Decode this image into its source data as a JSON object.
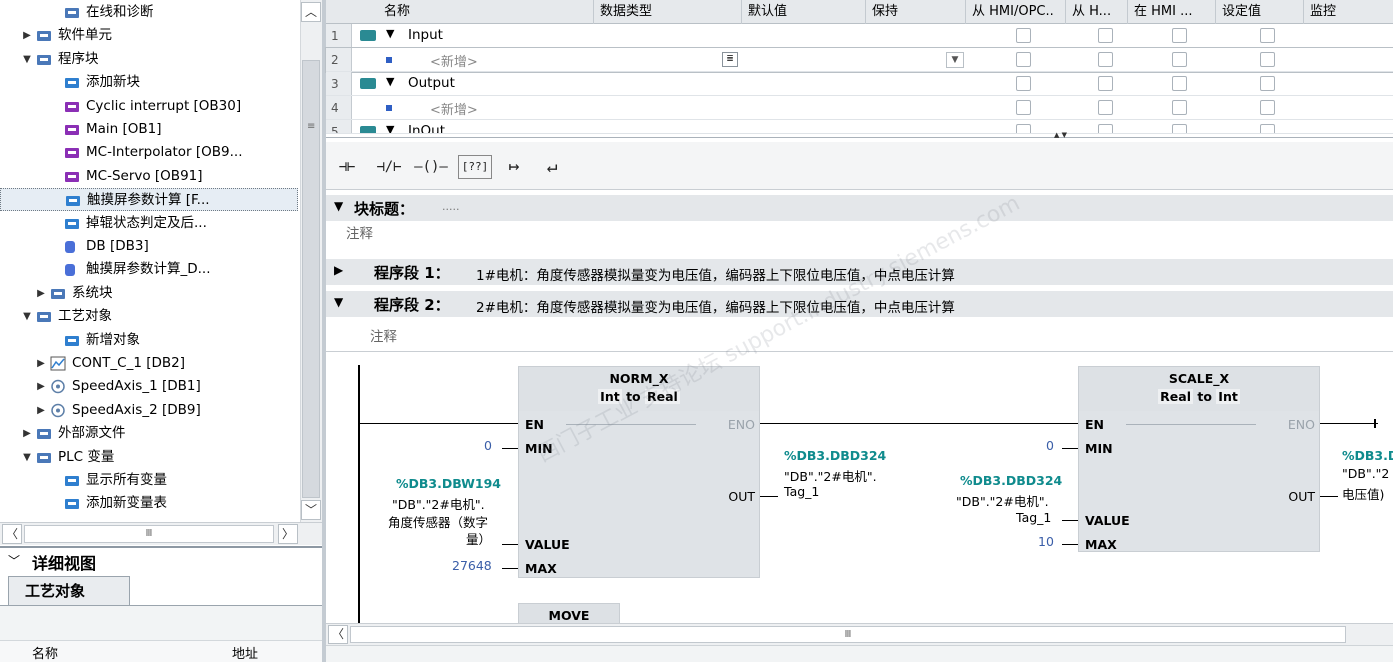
{
  "tree": {
    "items": [
      {
        "label": "在线和诊断",
        "icon": "online-diagnostics-icon",
        "arrow": ""
      },
      {
        "label": "软件单元",
        "icon": "software-unit-icon",
        "arrow": "▶"
      },
      {
        "label": "程序块",
        "icon": "program-blocks-icon",
        "arrow": "▼"
      },
      {
        "label": "添加新块",
        "icon": "add-block-icon",
        "arrow": ""
      },
      {
        "label": "Cyclic interrupt [OB30]",
        "icon": "ob-icon",
        "arrow": ""
      },
      {
        "label": "Main [OB1]",
        "icon": "ob-icon",
        "arrow": ""
      },
      {
        "label": "MC-Interpolator [OB9...",
        "icon": "ob-mc-icon",
        "arrow": ""
      },
      {
        "label": "MC-Servo [OB91]",
        "icon": "ob-mc-icon",
        "arrow": ""
      },
      {
        "label": "触摸屏参数计算 [F...",
        "icon": "fc-icon",
        "arrow": ""
      },
      {
        "label": "掉辊状态判定及后...",
        "icon": "fc-icon",
        "arrow": ""
      },
      {
        "label": "DB [DB3]",
        "icon": "db-icon",
        "arrow": ""
      },
      {
        "label": "触摸屏参数计算_D...",
        "icon": "db-icon",
        "arrow": ""
      },
      {
        "label": "系统块",
        "icon": "system-blocks-icon",
        "arrow": "▶"
      },
      {
        "label": "工艺对象",
        "icon": "technology-objects-icon",
        "arrow": "▼"
      },
      {
        "label": "新增对象",
        "icon": "add-object-icon",
        "arrow": ""
      },
      {
        "label": "CONT_C_1 [DB2]",
        "icon": "pid-icon",
        "arrow": "▶"
      },
      {
        "label": "SpeedAxis_1 [DB1]",
        "icon": "axis-icon",
        "arrow": "▶"
      },
      {
        "label": "SpeedAxis_2 [DB9]",
        "icon": "axis-icon",
        "arrow": "▶"
      },
      {
        "label": "外部源文件",
        "icon": "external-sources-icon",
        "arrow": "▶"
      },
      {
        "label": "PLC 变量",
        "icon": "plc-tags-icon",
        "arrow": "▼"
      },
      {
        "label": "显示所有变量",
        "icon": "show-tags-icon",
        "arrow": ""
      },
      {
        "label": "添加新变量表",
        "icon": "add-tag-table-icon",
        "arrow": ""
      }
    ],
    "scroll_mid": "Ⅲ"
  },
  "detail": {
    "title": "详细视图",
    "tab": "工艺对象",
    "col_name": "名称",
    "col_addr": "地址"
  },
  "interface": {
    "columns": [
      "名称",
      "数据类型",
      "默认值",
      "保持",
      "从 HMI/OPC..",
      "从 H...",
      "在 HMI ...",
      "设定值",
      "监控"
    ],
    "rows": [
      {
        "num": "1",
        "name": "Input",
        "kind": "section"
      },
      {
        "num": "2",
        "name": "<新增>",
        "kind": "add"
      },
      {
        "num": "3",
        "name": "Output",
        "kind": "section"
      },
      {
        "num": "4",
        "name": "<新增>",
        "kind": "add"
      },
      {
        "num": "5",
        "name": "InOut",
        "kind": "section"
      }
    ]
  },
  "toolbar": {
    "buttons": [
      {
        "label": "⊣⊢",
        "name": "no-contact-button"
      },
      {
        "label": "⊣/⊢",
        "name": "nc-contact-button"
      },
      {
        "label": "–()–",
        "name": "coil-button"
      },
      {
        "label": "[??]",
        "name": "empty-box-button"
      },
      {
        "label": "↦",
        "name": "open-branch-button"
      },
      {
        "label": "↵",
        "name": "close-branch-button"
      }
    ]
  },
  "editor": {
    "block_title_label": "块标题：",
    "block_title_value": ".....",
    "comment_label": "注释",
    "net1_label": "程序段 1：",
    "net1_text": "1#电机：角度传感器模拟量变为电压值，编码器上下限位电压值，中点电压计算",
    "net2_label": "程序段 2：",
    "net2_text": "2#电机：角度传感器模拟量变为电压值，编码器上下限位电压值，中点电压计算",
    "net2_comment": "注释",
    "watermark": "西门子工业 支持论坛 support.industry.siemens.com",
    "norm": {
      "title": "NORM_X",
      "type_from": "Int",
      "to": "to",
      "type_to": "Real",
      "en": "EN",
      "eno": "ENO",
      "min": "MIN",
      "value": "VALUE",
      "max": "MAX",
      "out": "OUT",
      "min_val": "0",
      "max_val": "27648",
      "value_addr": "%DB3.DBW194",
      "value_sym1": "\"DB\".\"2#电机\".",
      "value_sym2": "角度传感器（数字",
      "value_sym3": "量）",
      "out_addr": "%DB3.DBD324",
      "out_sym1": "\"DB\".\"2#电机\".",
      "out_sym2": "Tag_1"
    },
    "scale": {
      "title": "SCALE_X",
      "type_from": "Real",
      "to": "to",
      "type_to": "Int",
      "en": "EN",
      "eno": "ENO",
      "min": "MIN",
      "value": "VALUE",
      "max": "MAX",
      "out": "OUT",
      "min_val": "0",
      "max_val": "10",
      "value_addr": "%DB3.DBD324",
      "value_sym1": "\"DB\".\"2#电机\".",
      "value_sym2": "Tag_1",
      "out_addr": "%DB3.D",
      "out_sym1": "\"DB\".\"2",
      "out_sym2": "电压值)"
    },
    "move_title": "MOVE",
    "scroll_mid": "Ⅲ"
  },
  "colors": {
    "accent": "#0f8b8d",
    "number": "#3a5ea8",
    "band": "#e4e7ea"
  }
}
